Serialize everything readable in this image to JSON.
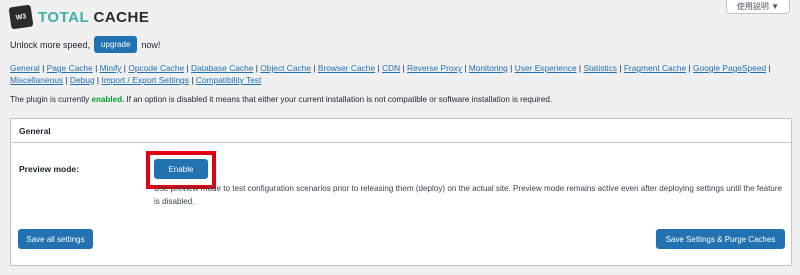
{
  "header": {
    "logo_badge": "W3",
    "logo_word1": "TOTAL",
    "logo_word2": "CACHE",
    "help_tab_label": "使用説明 ▼"
  },
  "upgrade": {
    "prefix": "Unlock more speed,",
    "button_label": "upgrade",
    "suffix": "now!"
  },
  "nav_links": [
    "General",
    "Page Cache",
    "Minify",
    "Opcode Cache",
    "Database Cache",
    "Object Cache",
    "Browser Cache",
    "CDN",
    "Reverse Proxy",
    "Monitoring",
    "User Experience",
    "Statistics",
    "Fragment Cache",
    "Google PageSpeed",
    "Miscellaneous",
    "Debug",
    "Import / Export Settings",
    "Compatibility Test"
  ],
  "status": {
    "prefix": "The plugin is currently",
    "state": "enabled.",
    "suffix": "If an option is disabled it means that either your current installation is not compatible or software installation is required."
  },
  "panel": {
    "title": "General",
    "preview_label": "Preview mode:",
    "enable_button": "Enable",
    "description": "Use preview mode to test configuration scenarios prior to releasing them (deploy) on the actual site. Preview mode remains active even after deploying settings until the feature is disabled.",
    "save_button": "Save all settings",
    "save_purge_button": "Save Settings & Purge Caches"
  },
  "colors": {
    "accent": "#2271b1",
    "enabled": "#00a32a",
    "highlight": "#e00012",
    "logo_teal": "#3cb0ad"
  }
}
